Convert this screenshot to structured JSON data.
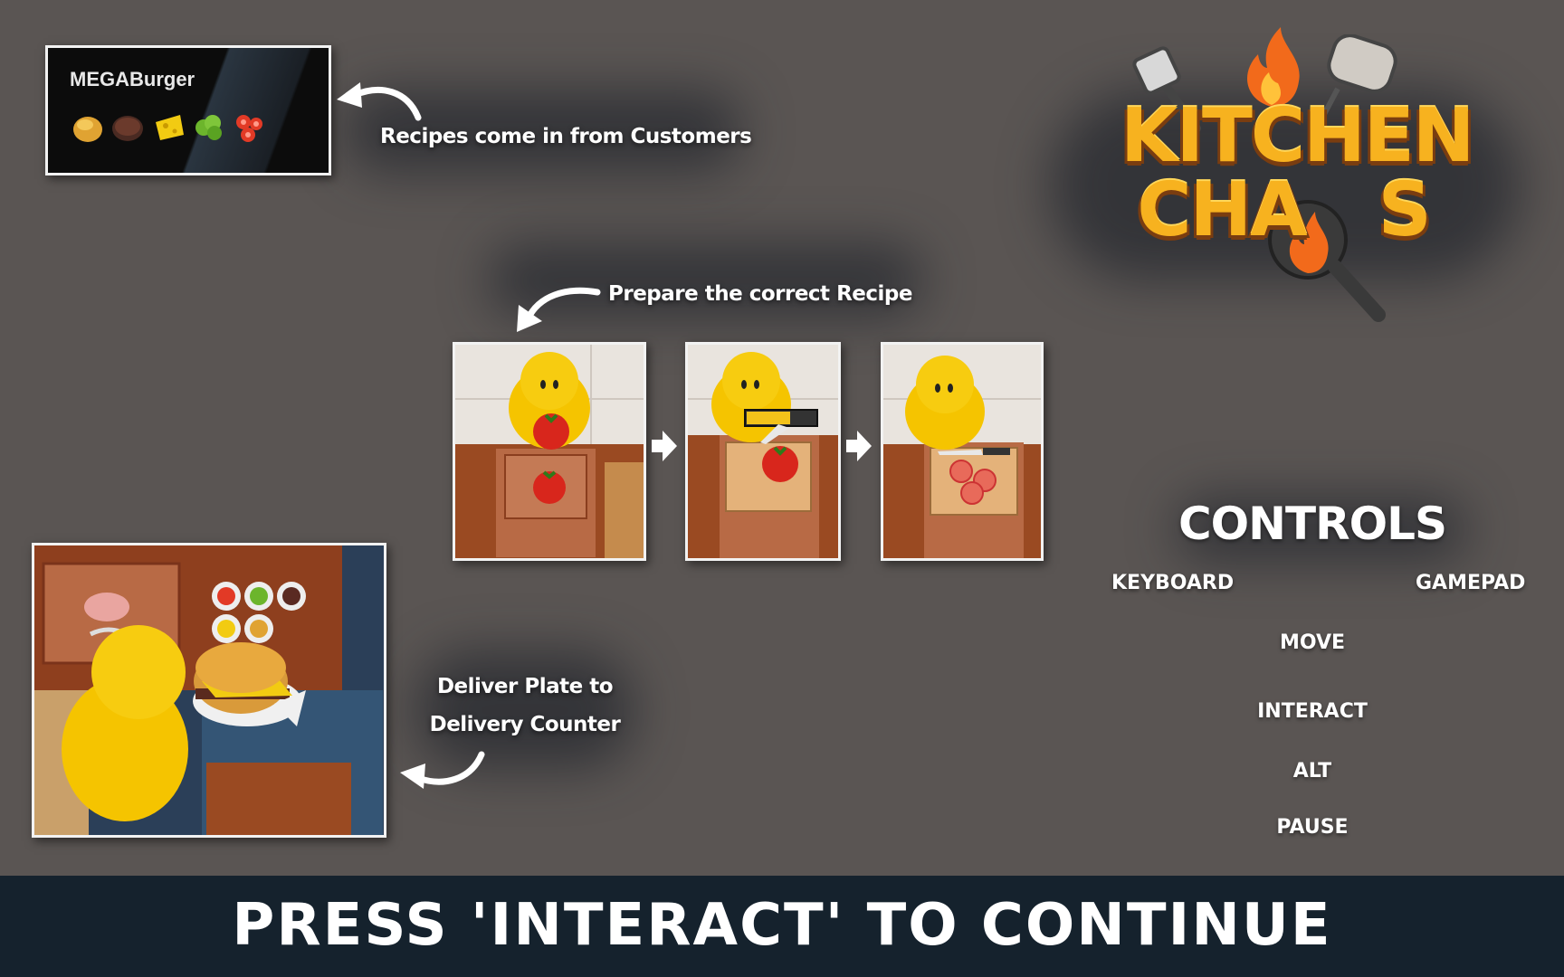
{
  "recipe_card": {
    "title": "MEGABurger",
    "ingredients": [
      "bun-icon",
      "patty-icon",
      "cheese-icon",
      "lettuce-icon",
      "tomato-icon"
    ]
  },
  "captions": {
    "recipes": "Recipes come in from Customers",
    "prepare": "Prepare the correct Recipe",
    "deliver_line1": "Deliver Plate to",
    "deliver_line2": "Delivery Counter"
  },
  "logo": {
    "line1": "KITCHEN",
    "line2": "CHA",
    "line2_end": "S"
  },
  "controls": {
    "title": "CONTROLS",
    "keyboard_label": "KEYBOARD",
    "gamepad_label": "GAMEPAD",
    "actions": [
      "MOVE",
      "INTERACT",
      "ALT",
      "PAUSE"
    ]
  },
  "footer": {
    "continue_text": "PRESS 'INTERACT' TO CONTINUE"
  },
  "colors": {
    "background": "#5a5553",
    "footer_bar": "#15222d",
    "logo_orange": "#f7b21f",
    "character_yellow": "#f5c400",
    "tomato_red": "#d8261c"
  }
}
